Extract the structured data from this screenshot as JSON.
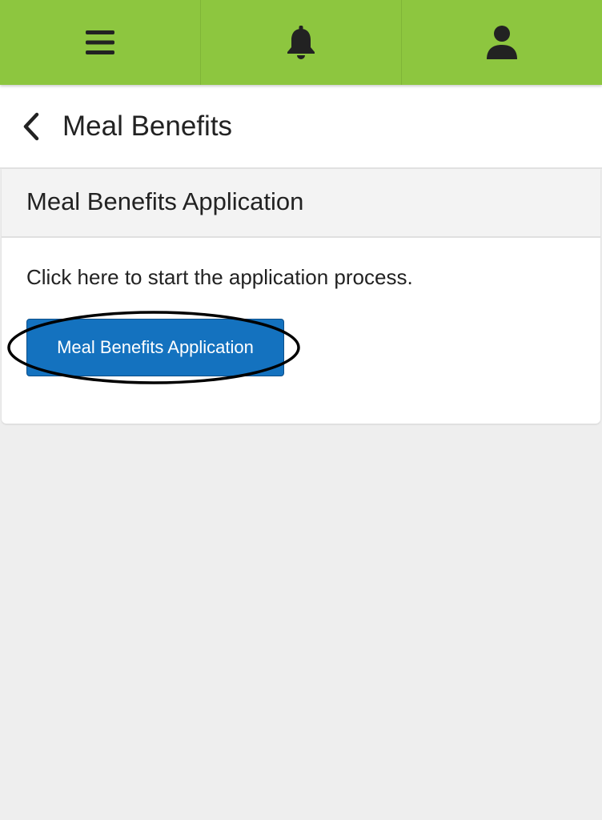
{
  "topbar": {
    "menu_icon": "hamburger-menu-icon",
    "notifications_icon": "bell-icon",
    "profile_icon": "user-icon",
    "background_color": "#8dc63f"
  },
  "titlebar": {
    "back_icon": "chevron-left-icon",
    "title": "Meal Benefits"
  },
  "card": {
    "header_title": "Meal Benefits Application",
    "description": "Click here to start the application process.",
    "button_label": "Meal Benefits Application",
    "button_color": "#1472bf"
  },
  "annotation": {
    "shape": "ellipse",
    "target": "apply-button",
    "color": "#000000"
  }
}
